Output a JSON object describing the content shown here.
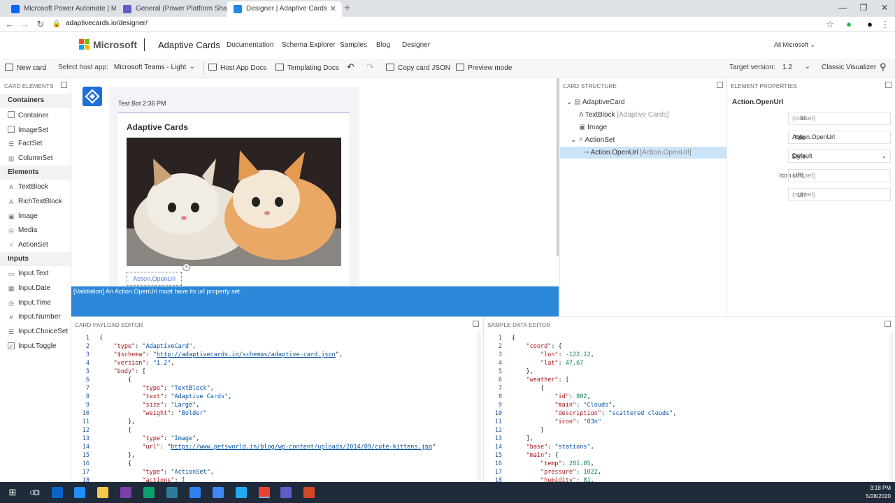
{
  "browser": {
    "tabs": [
      {
        "title": "Microsoft Power Automate | Mic",
        "color": "#0066ff"
      },
      {
        "title": "General (Power Platform Share) |",
        "color": "#5b5fc7"
      },
      {
        "title": "Designer | Adaptive Cards",
        "color": "#1e88e5"
      }
    ],
    "url": "adaptivecards.io/designer/"
  },
  "site": {
    "brand": "Microsoft",
    "product": "Adaptive Cards",
    "nav": [
      "Documentation",
      "Schema Explorer",
      "Samples",
      "Blog",
      "Designer"
    ],
    "all_microsoft": "All Microsoft"
  },
  "toolbar": {
    "new_card": "New card",
    "select_host_label": "Select host app:",
    "host_app": "Microsoft Teams - Light",
    "host_app_docs": "Host App Docs",
    "templating_docs": "Templating Docs",
    "copy_json": "Copy card JSON",
    "preview_mode": "Preview mode",
    "target_version_label": "Target version:",
    "target_version": "1.2",
    "classic_visualizer": "Classic Visualizer"
  },
  "card_elements": {
    "header": "CARD ELEMENTS",
    "groups": [
      {
        "label": "Containers",
        "items": [
          "Container",
          "ImageSet",
          "FactSet",
          "ColumnSet"
        ]
      },
      {
        "label": "Elements",
        "items": [
          "TextBlock",
          "RichTextBlock",
          "Image",
          "Media",
          "ActionSet"
        ]
      },
      {
        "label": "Inputs",
        "items": [
          "Input.Text",
          "Input.Date",
          "Input.Time",
          "Input.Number",
          "Input.ChoiceSet",
          "Input.Toggle"
        ]
      }
    ]
  },
  "preview": {
    "sender": "Test Bot 2:36 PM",
    "card_title": "Adaptive Cards",
    "action_label": "Action.OpenUrl"
  },
  "validation": "[Validation] An Action.OpenUrl must have its url property set.",
  "structure": {
    "header": "CARD STRUCTURE",
    "nodes": [
      {
        "label": "AdaptiveCard",
        "note": ""
      },
      {
        "label": "TextBlock",
        "note": "[Adaptive Cards]"
      },
      {
        "label": "Image",
        "note": ""
      },
      {
        "label": "ActionSet",
        "note": ""
      },
      {
        "label": "Action.OpenUrl",
        "note": "[Action.OpenUrl]"
      }
    ]
  },
  "properties": {
    "header": "ELEMENT PROPERTIES",
    "element": "Action.OpenUrl",
    "fields": [
      {
        "label": "Id",
        "value": "(not set)"
      },
      {
        "label": "Title",
        "value": "Action.OpenUrl"
      },
      {
        "label": "Style",
        "value": "Default"
      },
      {
        "label": "Icon URL",
        "value": "(not set)"
      },
      {
        "label": "Url",
        "value": "(not set)"
      }
    ]
  },
  "payload_editor": {
    "header": "CARD PAYLOAD EDITOR",
    "lines": [
      "{",
      "    \"type\": \"AdaptiveCard\",",
      "    \"$schema\": \"http://adaptivecards.io/schemas/adaptive-card.json\",",
      "    \"version\": \"1.2\",",
      "    \"body\": [",
      "        {",
      "            \"type\": \"TextBlock\",",
      "            \"text\": \"Adaptive Cards\",",
      "            \"size\": \"Large\",",
      "            \"weight\": \"Bolder\"",
      "        },",
      "        {",
      "            \"type\": \"Image\",",
      "            \"url\": \"https://www.petsworld.in/blog/wp-content/uploads/2014/09/cute-kittens.jpg\"",
      "        },",
      "        {",
      "            \"type\": \"ActionSet\",",
      "            \"actions\": ["
    ]
  },
  "data_editor": {
    "header": "SAMPLE DATA EDITOR",
    "lines": [
      "{",
      "    \"coord\": {",
      "        \"lon\": -122.12,",
      "        \"lat\": 47.67",
      "    },",
      "    \"weather\": [",
      "        {",
      "            \"id\": 802,",
      "            \"main\": \"Clouds\",",
      "            \"description\": \"scattered clouds\",",
      "            \"icon\": \"03n\"",
      "        }",
      "    ],",
      "    \"base\": \"stations\",",
      "    \"main\": {",
      "        \"temp\": 281.05,",
      "        \"pressure\": 1022,",
      "        \"humidity\": 81,"
    ]
  },
  "taskbar": {
    "time": "3:18 PM",
    "date": "5/28/2020",
    "apps": [
      "start-icon",
      "search-icon",
      "task-view-icon",
      "outlook-icon",
      "ie-icon",
      "file-explorer-icon",
      "onenote-icon",
      "edge-icon",
      "edge-beta-icon",
      "mail-icon",
      "chrome-icon",
      "vscode-icon",
      "chrome-active-icon",
      "teams-icon",
      "powerpoint-icon"
    ]
  }
}
